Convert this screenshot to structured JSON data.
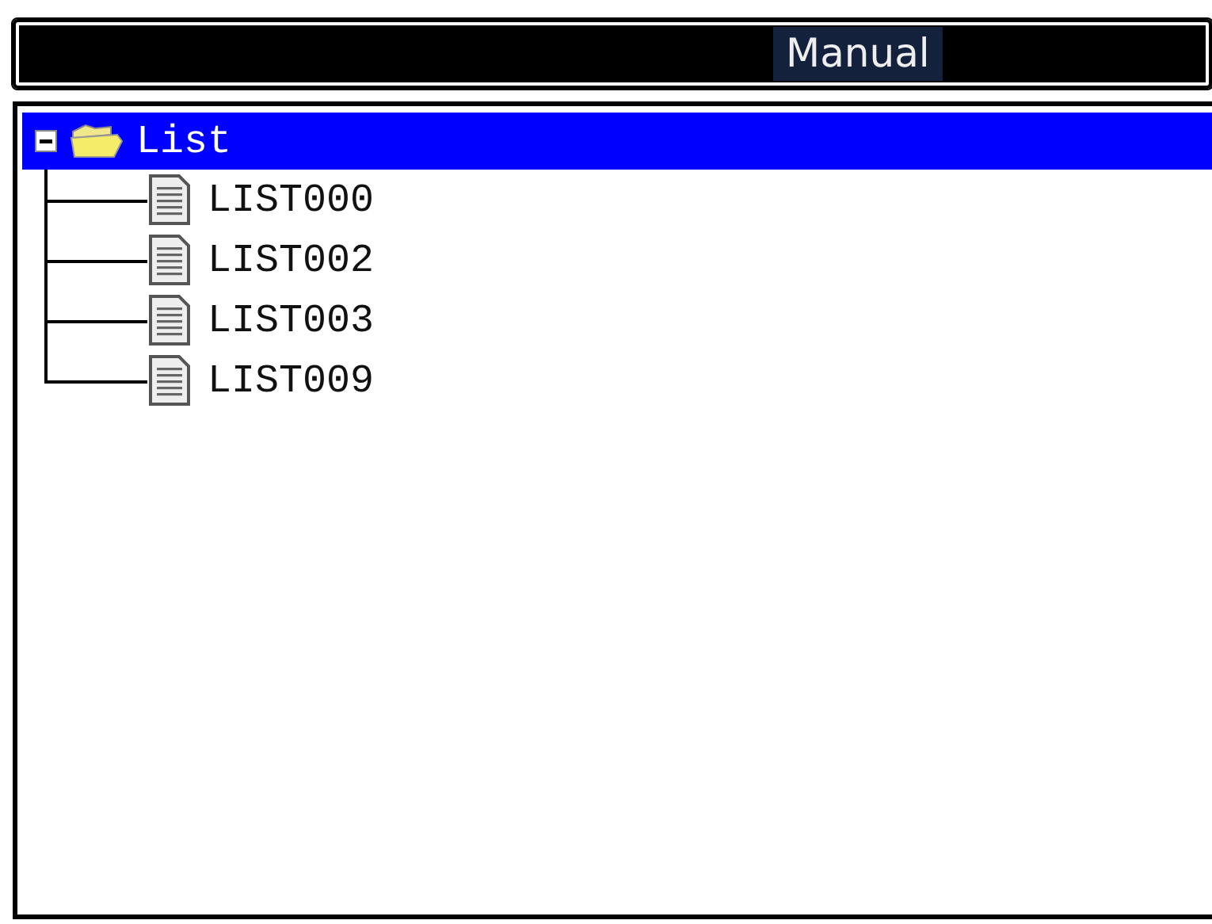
{
  "header": {
    "title": "Manual"
  },
  "tree": [
    {
      "label": "List",
      "kind": "folder",
      "expanded": true,
      "selected": true,
      "children": [
        {
          "label": "LIST000",
          "kind": "file",
          "selected": false
        },
        {
          "label": "LIST002",
          "kind": "file",
          "selected": false
        },
        {
          "label": "LIST003",
          "kind": "file",
          "selected": false
        },
        {
          "label": "LIST009",
          "kind": "file",
          "selected": false
        }
      ]
    }
  ]
}
